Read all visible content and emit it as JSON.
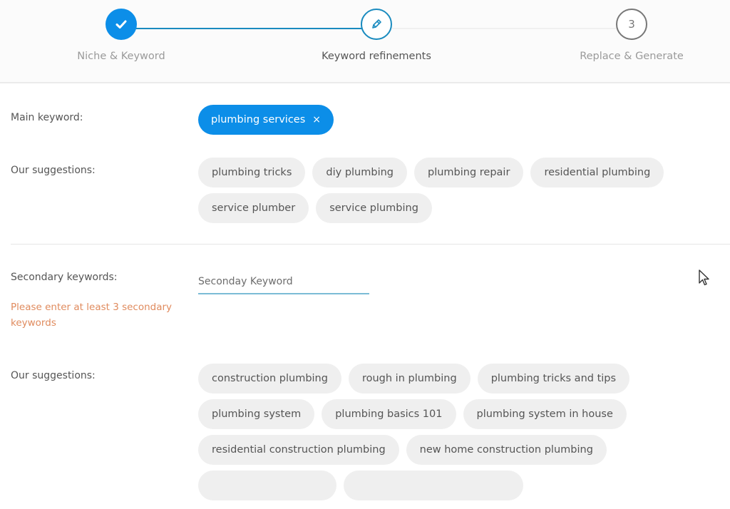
{
  "stepper": {
    "steps": [
      {
        "label": "Niche & Keyword",
        "state": "done",
        "icon": "check-icon"
      },
      {
        "label": "Keyword refinements",
        "state": "active",
        "icon": "pencil-icon"
      },
      {
        "label": "Replace & Generate",
        "state": "pending",
        "number": "3"
      }
    ]
  },
  "main_keyword": {
    "label": "Main keyword:",
    "value": "plumbing services",
    "remove_icon": "×"
  },
  "main_suggestions": {
    "label": "Our suggestions:",
    "items": [
      "plumbing tricks",
      "diy plumbing",
      "plumbing repair",
      "residential plumbing",
      "service plumber",
      "service plumbing"
    ]
  },
  "secondary_keywords": {
    "label": "Secondary keywords:",
    "input_value": "",
    "placeholder": "Seconday Keyword",
    "error": "Please enter at least 3 secondary keywords"
  },
  "secondary_suggestions": {
    "label": "Our suggestions:",
    "items": [
      "construction plumbing",
      "rough in plumbing",
      "plumbing tricks and tips",
      "plumbing system",
      "plumbing basics 101",
      "plumbing system in house",
      "residential construction plumbing",
      "new home construction plumbing"
    ]
  },
  "colors": {
    "accent": "#0c8ee8",
    "line": "#1a8bbf",
    "chip_bg": "#efefef",
    "error": "#e08b5e"
  }
}
